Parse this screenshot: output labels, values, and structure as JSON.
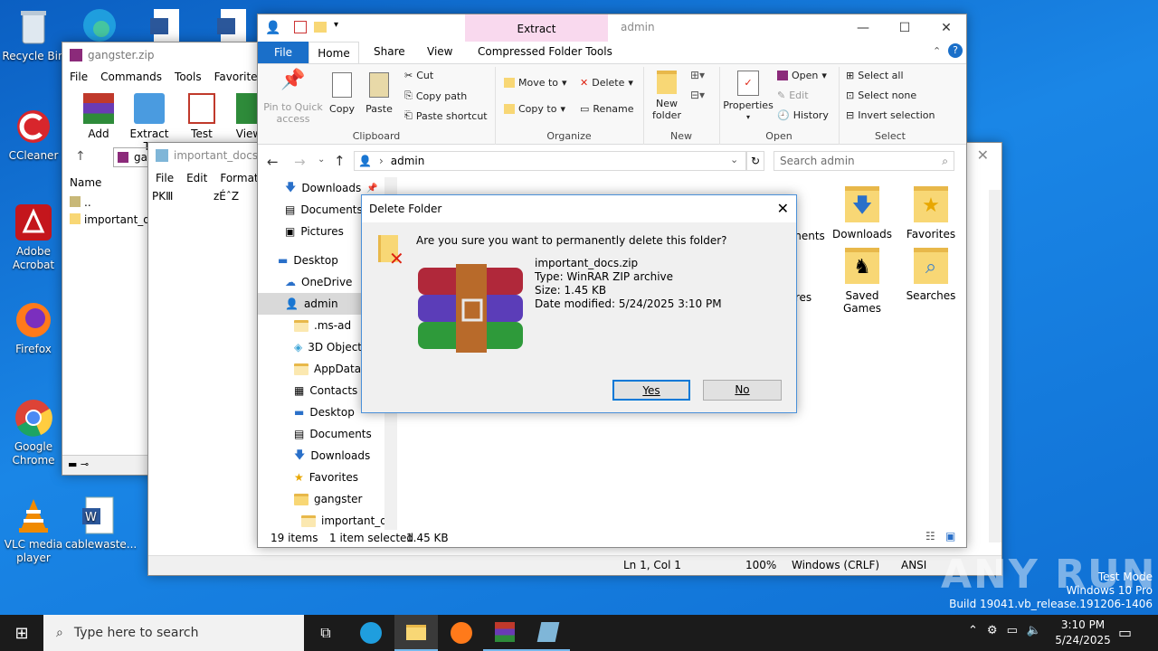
{
  "desktop_icons": [
    {
      "label": "Recycle Bin"
    },
    {
      "label": "CCleaner"
    },
    {
      "label": "Adobe Acrobat"
    },
    {
      "label": "Firefox"
    },
    {
      "label": "Google Chrome"
    },
    {
      "label": "VLC media player"
    },
    {
      "label": "cablewaste..."
    }
  ],
  "winrar": {
    "title": "gangster.zip",
    "menu": [
      "File",
      "Commands",
      "Tools",
      "Favorites"
    ],
    "toolbar": [
      "Add",
      "Extract To",
      "Test",
      "View"
    ],
    "path": "gan",
    "col_name": "Name",
    "rows": [
      "..",
      "important_do"
    ]
  },
  "notepad": {
    "title": "important_docs.t",
    "menu": [
      "File",
      "Edit",
      "Format"
    ],
    "content_a": "PKⅢ",
    "content_b": "zÉˆZ",
    "status": {
      "pos": "Ln 1, Col 1",
      "zoom": "100%",
      "eol": "Windows (CRLF)",
      "enc": "ANSI"
    }
  },
  "explorer": {
    "title": "admin",
    "context_tab": "Extract",
    "context_group": "Compressed Folder Tools",
    "tabs": [
      "File",
      "Home",
      "Share",
      "View"
    ],
    "clipboard": {
      "pin": "Pin to Quick access",
      "copy": "Copy",
      "paste": "Paste",
      "cut": "Cut",
      "copy_path": "Copy path",
      "paste_shortcut": "Paste shortcut",
      "label": "Clipboard"
    },
    "organize": {
      "move_to": "Move to",
      "copy_to": "Copy to",
      "delete": "Delete",
      "rename": "Rename",
      "label": "Organize"
    },
    "new": {
      "new_folder": "New folder",
      "label": "New"
    },
    "open": {
      "properties": "Properties",
      "open": "Open",
      "edit": "Edit",
      "history": "History",
      "label": "Open"
    },
    "select": {
      "all": "Select all",
      "none": "Select none",
      "invert": "Invert selection",
      "label": "Select"
    },
    "address": "admin",
    "search_placeholder": "Search admin",
    "nav": [
      "Downloads",
      "Documents",
      "Pictures",
      "Desktop",
      "OneDrive",
      "admin",
      ".ms-ad",
      "3D Objects",
      "AppData",
      "Contacts",
      "Desktop",
      "Documents",
      "Downloads",
      "Favorites",
      "gangster",
      "important_dc"
    ],
    "items": [
      "nents",
      "Downloads",
      "Favorites",
      "res",
      "Saved Games",
      "Searches"
    ],
    "status": {
      "count": "19 items",
      "selected": "1 item selected",
      "size": "1.45 KB"
    }
  },
  "dialog": {
    "title": "Delete Folder",
    "question": "Are you sure you want to permanently delete this folder?",
    "file_name": "important_docs.zip",
    "file_type": "Type: WinRAR ZIP archive",
    "file_size": "Size: 1.45 KB",
    "file_date": "Date modified: 5/24/2025 3:10 PM",
    "yes": "Yes",
    "no": "No"
  },
  "watermark": {
    "brand": "ANY RUN",
    "line1": "Test Mode",
    "line2": "Windows 10 Pro",
    "line3": "Build 19041.vb_release.191206-1406"
  },
  "taskbar": {
    "search_placeholder": "Type here to search",
    "time": "3:10 PM",
    "date": "5/24/2025"
  }
}
